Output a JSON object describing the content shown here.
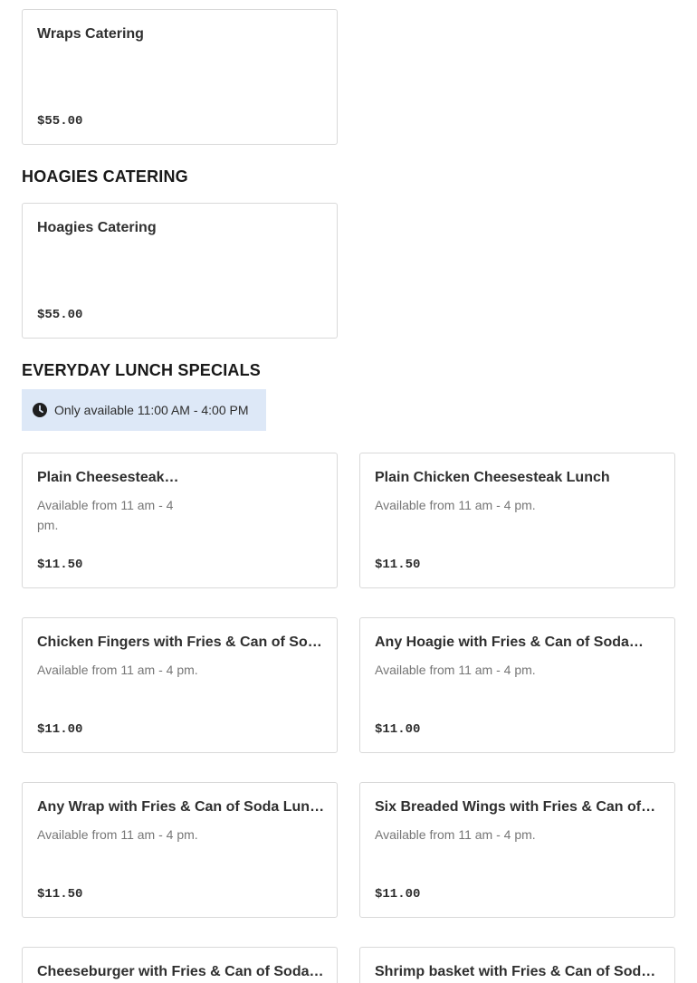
{
  "sections": {
    "wraps": {
      "items": [
        {
          "title": "Wraps Catering",
          "desc": "",
          "price": "$55.00"
        }
      ]
    },
    "hoagies": {
      "heading": "HOAGIES CATERING",
      "items": [
        {
          "title": "Hoagies Catering",
          "desc": "",
          "price": "$55.00"
        }
      ]
    },
    "lunch": {
      "heading": "EVERYDAY LUNCH SPECIALS",
      "availability": "Only available 11:00 AM - 4:00 PM",
      "availability_icon": "clock-icon",
      "items": [
        {
          "title": "Plain Cheesesteak…",
          "desc": "Available from 11 am - 4 pm.",
          "price": "$11.50"
        },
        {
          "title": "Plain Chicken Cheesesteak Lunch",
          "desc": "Available from 11 am - 4 pm.",
          "price": "$11.50"
        },
        {
          "title": "Chicken Fingers with Fries & Can of Soda…",
          "desc": "Available from 11 am - 4 pm.",
          "price": "$11.00"
        },
        {
          "title": "Any Hoagie with Fries & Can of Soda…",
          "desc": "Available from 11 am - 4 pm.",
          "price": "$11.00"
        },
        {
          "title": "Any Wrap with Fries & Can of Soda Lunch",
          "desc": "Available from 11 am - 4 pm.",
          "price": "$11.50"
        },
        {
          "title": "Six Breaded Wings with Fries & Can of…",
          "desc": "Available from 11 am - 4 pm.",
          "price": "$11.00"
        },
        {
          "title": "Cheeseburger with Fries & Can of Soda…",
          "desc": "",
          "price": ""
        },
        {
          "title": "Shrimp basket with Fries & Can of Soda…",
          "desc": "",
          "price": ""
        }
      ]
    }
  }
}
